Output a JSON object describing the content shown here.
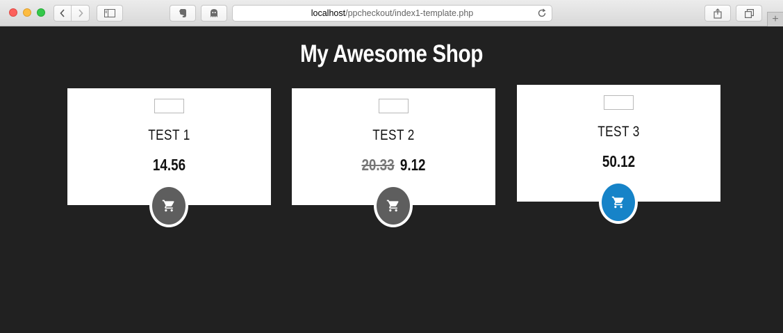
{
  "browser": {
    "url_host": "localhost",
    "url_path": "/ppcheckout/index1-template.php",
    "icons": [
      "back-icon",
      "forward-icon",
      "sidebar-icon",
      "evernote-icon",
      "ghostery-icon",
      "reload-icon",
      "share-icon",
      "tabs-icon",
      "plus-icon"
    ],
    "new_tab_symbol": "+"
  },
  "page": {
    "title": "My Awesome Shop"
  },
  "products": [
    {
      "name": "TEST 1",
      "old_price": "",
      "price": "14.56",
      "cart_color": "#5e5e5e"
    },
    {
      "name": "TEST 2",
      "old_price": "20.33",
      "price": "9.12",
      "cart_color": "#5e5e5e"
    },
    {
      "name": "TEST 3",
      "old_price": "",
      "price": "50.12",
      "cart_color": "#1683c8"
    }
  ]
}
